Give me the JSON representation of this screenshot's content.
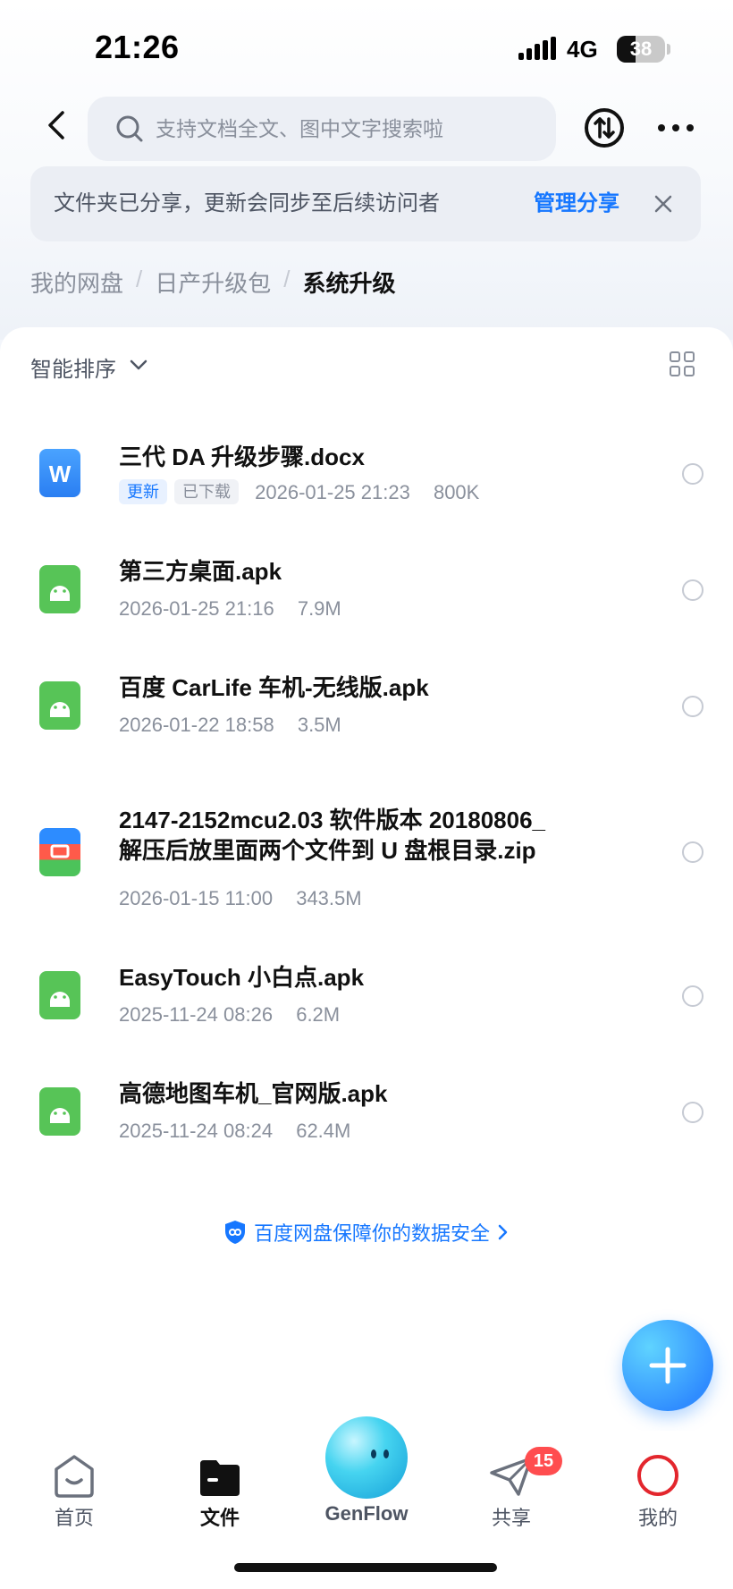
{
  "status_bar": {
    "time": "21:26",
    "network": "4G",
    "battery": "38",
    "battery_level": 0.38
  },
  "header": {
    "search_placeholder": "支持文档全文、图中文字搜索啦"
  },
  "share_banner": {
    "text": "文件夹已分享，更新会同步至后续访问者",
    "action": "管理分享"
  },
  "breadcrumb": {
    "items": [
      "我的网盘",
      "日产升级包",
      "系统升级"
    ],
    "separator": "/"
  },
  "toolbar": {
    "sort_label": "智能排序"
  },
  "files": [
    {
      "name": "三代 DA 升级步骤.docx",
      "type": "word",
      "tags": [
        "更新",
        "已下载"
      ],
      "date": "2026-01-25 21:23",
      "size": "800K"
    },
    {
      "name": "第三方桌面.apk",
      "type": "apk",
      "tags": [],
      "date": "2026-01-25 21:16",
      "size": "7.9M"
    },
    {
      "name": "百度 CarLife 车机-无线版.apk",
      "type": "apk",
      "tags": [],
      "date": "2026-01-22 18:58",
      "size": "3.5M"
    },
    {
      "name_line1": "2147-2152mcu2.03 软件版本 20180806_",
      "name_line2": "解压后放里面两个文件到 U 盘根目录.zip",
      "type": "zip",
      "tags": [],
      "date": "2026-01-15 11:00",
      "size": "343.5M"
    },
    {
      "name": "EasyTouch 小白点.apk",
      "type": "apk",
      "tags": [],
      "date": "2025-11-24 08:26",
      "size": "6.2M"
    },
    {
      "name": "高德地图车机_官网版.apk",
      "type": "apk",
      "tags": [],
      "date": "2025-11-24 08:24",
      "size": "62.4M"
    }
  ],
  "safety_notice": "百度网盘保障你的数据安全",
  "tabbar": {
    "items": [
      {
        "label": "首页",
        "icon": "home-icon"
      },
      {
        "label": "文件",
        "icon": "folder-icon",
        "active": true
      },
      {
        "label": "GenFlow",
        "icon": "genflow-orb"
      },
      {
        "label": "共享",
        "icon": "send-icon",
        "badge": "15"
      },
      {
        "label": "我的",
        "icon": "profile-icon"
      }
    ]
  },
  "colors": {
    "accent": "#1677ff",
    "badge": "#ff4d4f",
    "apk_green": "#57c457"
  }
}
